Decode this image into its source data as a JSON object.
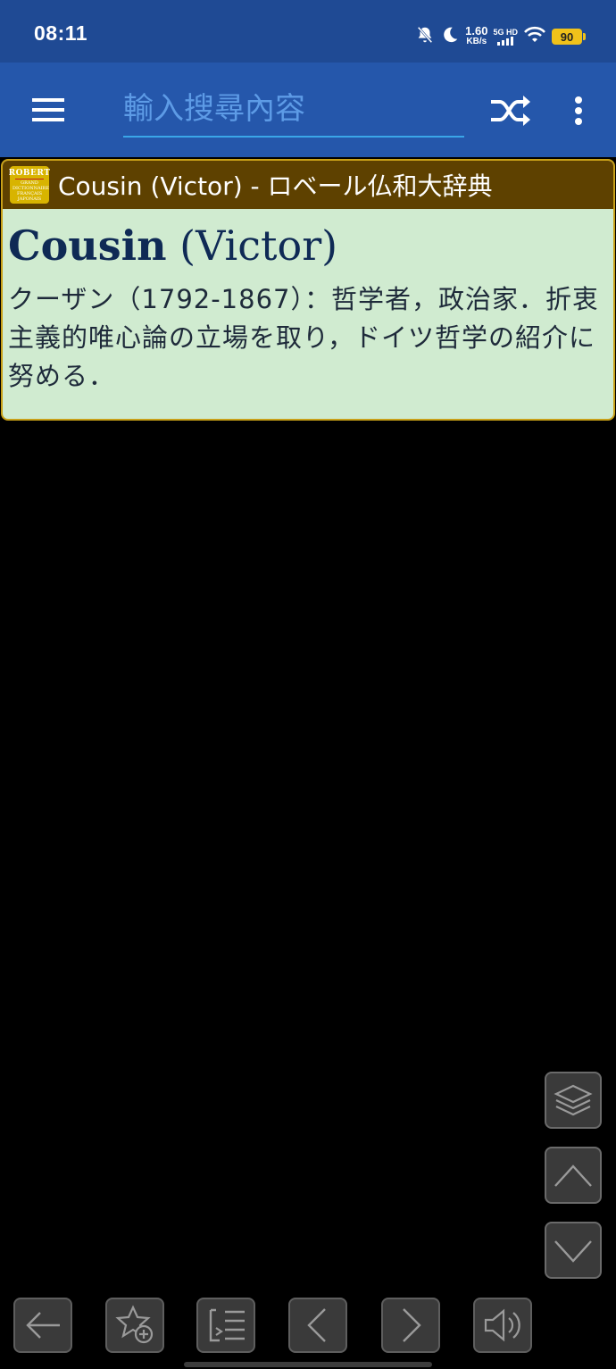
{
  "status_bar": {
    "time": "08:11",
    "speed_value": "1.60",
    "speed_unit": "KB/s",
    "network_top": "5G HD",
    "battery": "90"
  },
  "app_bar": {
    "search_placeholder": "輸入搜尋內容",
    "search_value": ""
  },
  "entry": {
    "dictionary_title": "Cousin (Victor) - ロベール仏和大辞典",
    "logo_text": "ROBERT",
    "logo_subtext": "GRAND DICTIONNAIRE FRANÇAIS JAPONAIS",
    "headword_bold": "Cousin",
    "headword_rest": " (Victor)",
    "definition": "クーザン（1792-1867）：哲学者，政治家．折衷主義的唯心論の立場を取り，ドイツ哲学の紹介に努める．"
  },
  "colors": {
    "status_bar": "#1f4a94",
    "app_bar": "#2557ab",
    "card_header": "#5e4100",
    "card_body": "#d0ebd0",
    "card_border": "#c8a018",
    "headword": "#0f2a55"
  }
}
